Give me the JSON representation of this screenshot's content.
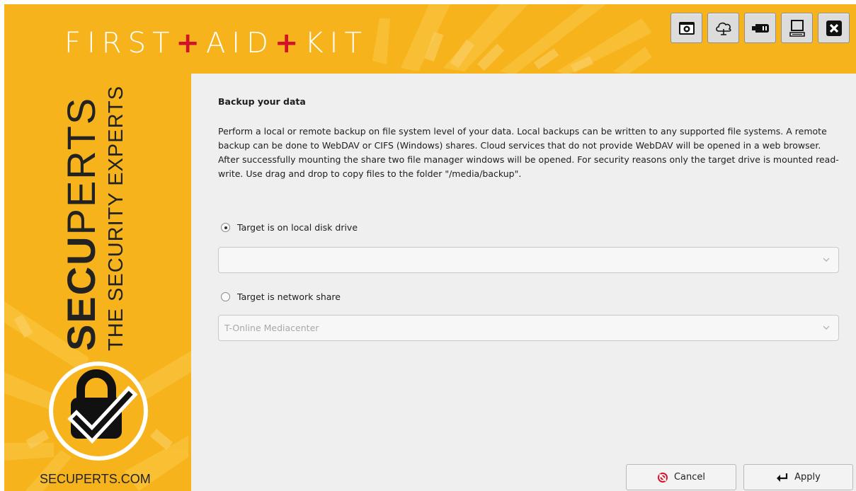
{
  "app": {
    "title_parts": [
      "FIRST",
      "+",
      "AID",
      "+",
      "KIT"
    ],
    "brand_bold": "SECU",
    "brand_rest": "PERTS",
    "tagline": "THE SECURITY EXPERTS",
    "website": "SECUPERTS.COM"
  },
  "toolbar": {
    "buttons": [
      {
        "icon": "browser-window-icon"
      },
      {
        "icon": "cloud-upload-icon"
      },
      {
        "icon": "usb-drive-icon"
      },
      {
        "icon": "computer-icon"
      },
      {
        "icon": "close-icon"
      }
    ]
  },
  "main": {
    "heading": "Backup your data",
    "description": "Perform a local or remote backup on file system level of your data. Local backups can be written to any supported file systems. A remote backup can be done to WebDAV or CIFS (Windows) shares. Cloud services that do not provide WebDAV will be opened in a web browser. After successfully mounting the share two file manager windows will be opened. For security reasons only the target drive is mounted read-write. Use drag and drop to copy files to the folder \"/media/backup\".",
    "options": [
      {
        "label": "Target is on local disk drive",
        "checked": true,
        "select_value": ""
      },
      {
        "label": "Target is network share",
        "checked": false,
        "select_value": "T-Online Mediacenter"
      }
    ]
  },
  "actions": {
    "cancel_label": "Cancel",
    "apply_label": "Apply"
  },
  "colors": {
    "accent_yellow": "#f6b31b",
    "plus_red": "#d2112a",
    "cancel_red": "#d4122a"
  }
}
